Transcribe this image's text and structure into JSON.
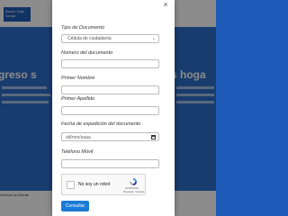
{
  "background": {
    "logo_text": "Banco Caja Social",
    "headline_left": "greso s",
    "headline_right": "s hoga",
    "bottom_text": "Servicio al Cliente"
  },
  "modal": {
    "close_symbol": "×",
    "fields": {
      "tipo_documento": {
        "label": "Tipo de Documento",
        "value": "Cédula de ciudadanía"
      },
      "numero_documento": {
        "label": "Número del documento",
        "value": ""
      },
      "primer_nombre": {
        "label": "Primer Nombre",
        "value": ""
      },
      "primer_apellido": {
        "label": "Primer Apellido",
        "value": ""
      },
      "fecha_expedicion": {
        "label": "Fecha de expedición del documento",
        "placeholder": "dd/mm/aaaa"
      },
      "telefono_movil": {
        "label": "Teléfono Móvil",
        "value": ""
      }
    },
    "recaptcha": {
      "label": "No soy un robot",
      "brand": "reCAPTCHA",
      "links": "Privacidad - Términos"
    },
    "submit_label": "Consultar"
  }
}
